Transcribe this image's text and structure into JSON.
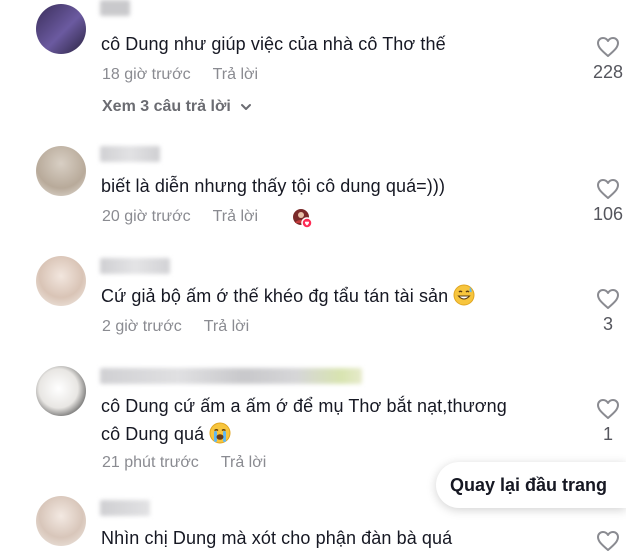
{
  "comments": [
    {
      "text": "cô Dung như giúp việc của nhà cô Thơ thế",
      "time": "18 giờ trước",
      "reply": "Trả lời",
      "likes": "228",
      "view_replies": "Xem 3 câu trả lời"
    },
    {
      "text": "biết là diễn nhưng thấy tội cô dung quá=)))",
      "time": "20 giờ trước",
      "reply": "Trả lời",
      "likes": "106"
    },
    {
      "text": "Cứ giả bộ ấm ớ thế khéo đg tẩu tán tài sản",
      "time": "2 giờ trước",
      "reply": "Trả lời",
      "likes": "3"
    },
    {
      "text_line1": "cô Dung cứ ấm a ấm ớ để mụ Thơ bắt nạt,thương",
      "text_line2": "cô Dung quá",
      "time": "21 phút trước",
      "reply": "Trả lời",
      "likes": "1"
    },
    {
      "text": "Nhìn chị Dung mà xót cho phận đàn bà quá"
    }
  ],
  "back_to_top": "Quay lại đầu trang",
  "colors": {
    "text": "#161823",
    "meta": "#8a8b91",
    "accent": "#fe2c55"
  },
  "icons": [
    "heart-outline-icon",
    "chevron-down-icon",
    "grin-sweat-emoji",
    "crying-emoji",
    "creator-liked-badge"
  ]
}
